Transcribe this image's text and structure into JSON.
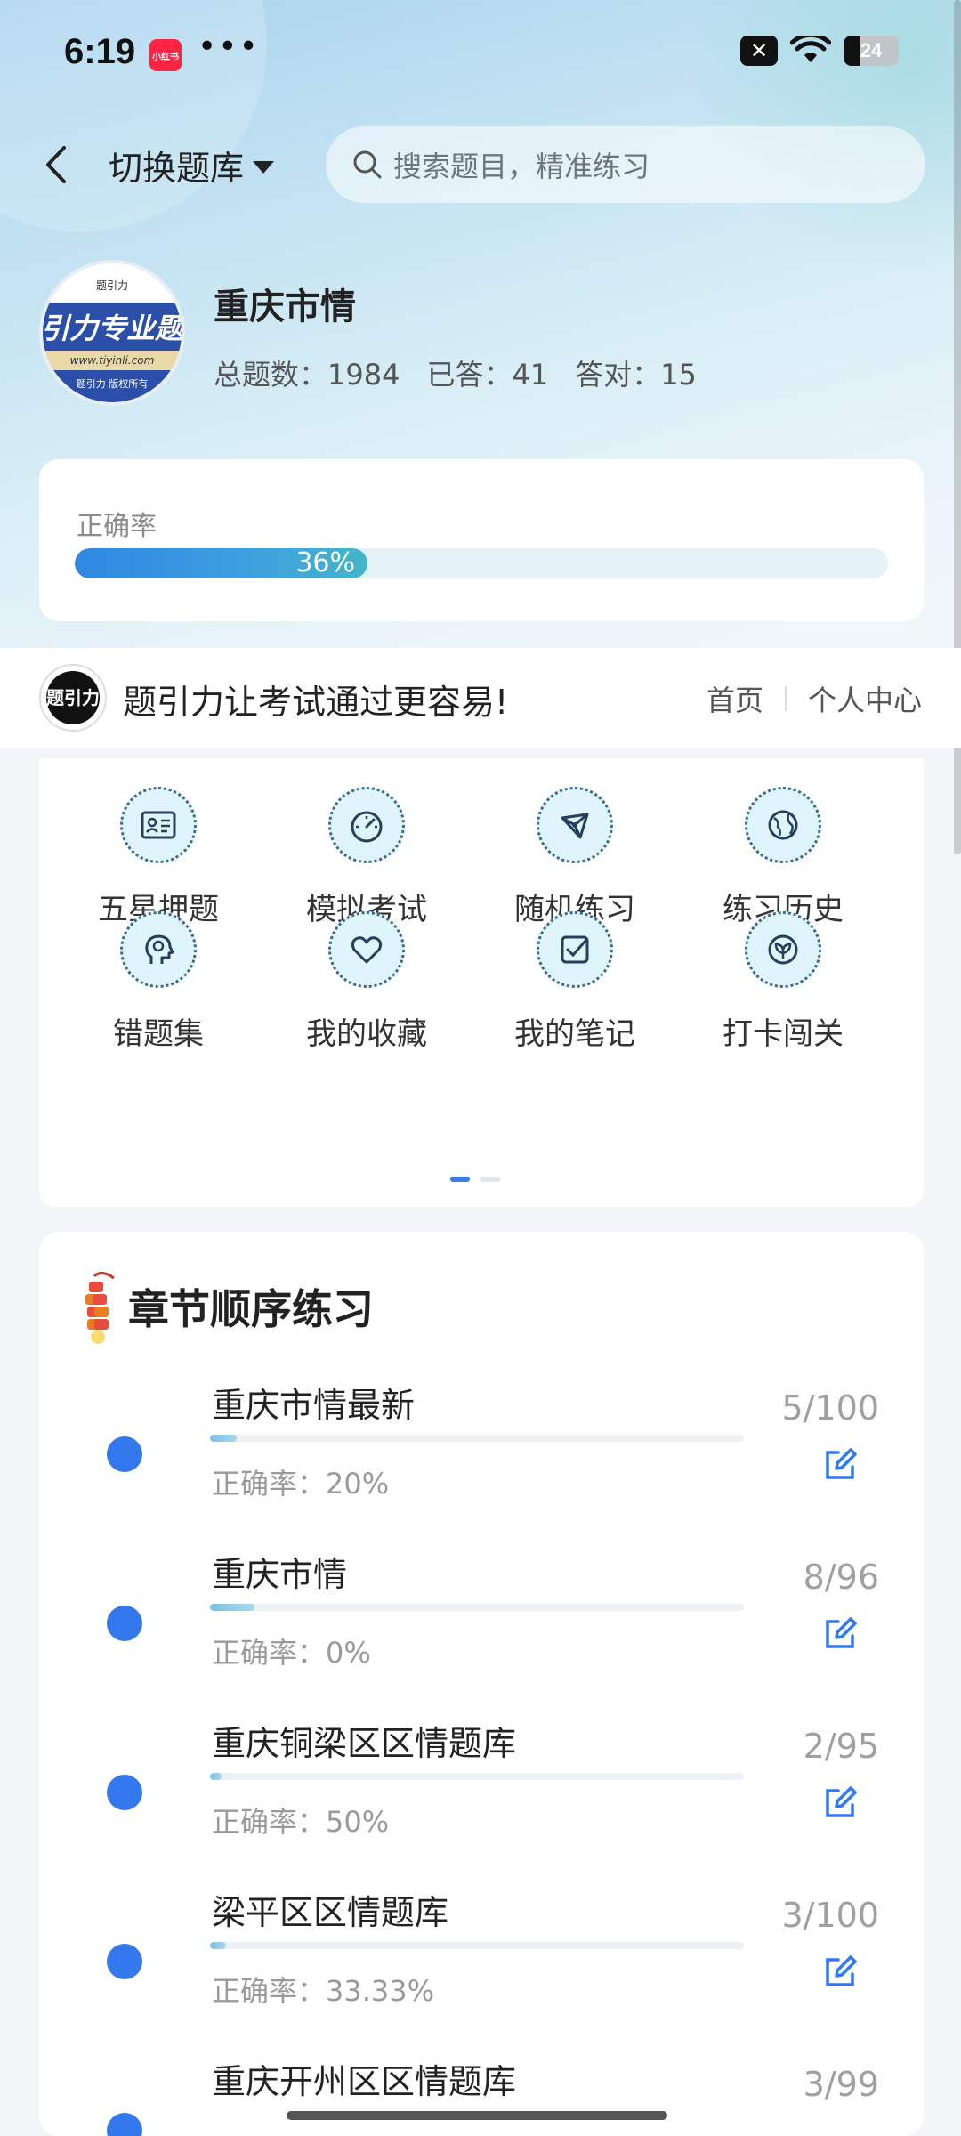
{
  "status_bar": {
    "time": "6:19",
    "app_badge": "小红书",
    "more": "•••",
    "close_badge": "✕",
    "battery": "24"
  },
  "top_bar": {
    "switch_label": "切换题库",
    "search_placeholder": "搜索题目，精准练习"
  },
  "profile": {
    "avatar_top": "题引力",
    "avatar_band": "引力专业题",
    "avatar_url": "www.tiyinli.com",
    "avatar_copy": "题引力 版权所有",
    "title": "重庆市情",
    "total_label": "总题数：1984",
    "answered_label": "已答：41",
    "correct_label": "答对：15"
  },
  "accuracy": {
    "label": "正确率",
    "percent_text": "36%",
    "percent": 36
  },
  "promo": {
    "logo_text": "题引力",
    "slogan": "题引力让考试通过更容易!",
    "nav_home": "首页",
    "nav_profile": "个人中心"
  },
  "features": [
    {
      "label": "五星押题",
      "icon": "id-card-icon"
    },
    {
      "label": "模拟考试",
      "icon": "gauge-icon"
    },
    {
      "label": "随机练习",
      "icon": "network-icon"
    },
    {
      "label": "练习历史",
      "icon": "globe-icon"
    },
    {
      "label": "错题集",
      "icon": "head-icon"
    },
    {
      "label": "我的收藏",
      "icon": "heart-icon"
    },
    {
      "label": "我的笔记",
      "icon": "checkbox-icon"
    },
    {
      "label": "打卡闯关",
      "icon": "leaf-icon"
    }
  ],
  "chapters": {
    "title": "章节顺序练习",
    "items": [
      {
        "name": "重庆市情最新",
        "accuracy": "正确率：20%",
        "count": "5/100",
        "progress": 0.05
      },
      {
        "name": "重庆市情",
        "accuracy": "正确率：0%",
        "count": "8/96",
        "progress": 0.083
      },
      {
        "name": "重庆铜梁区区情题库",
        "accuracy": "正确率：50%",
        "count": "2/95",
        "progress": 0.021
      },
      {
        "name": "梁平区区情题库",
        "accuracy": "正确率：33.33%",
        "count": "3/100",
        "progress": 0.03
      },
      {
        "name": "重庆开州区区情题库",
        "accuracy": "",
        "count": "3/99",
        "progress": 0.03
      }
    ]
  },
  "colors": {
    "accent": "#3478ee",
    "progress_start": "#2f87e3",
    "progress_end": "#44b6c8"
  }
}
